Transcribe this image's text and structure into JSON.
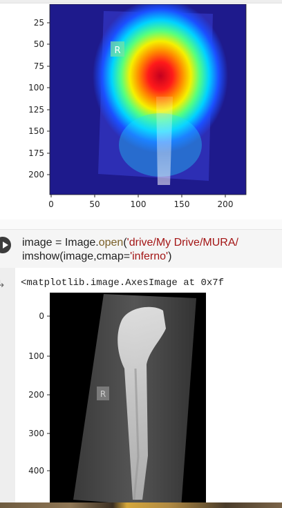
{
  "plot1": {
    "y_ticks": [
      "25",
      "50",
      "75",
      "100",
      "125",
      "150",
      "175",
      "200"
    ],
    "x_ticks": [
      "0",
      "50",
      "100",
      "150",
      "200"
    ],
    "marker_letter": "R"
  },
  "code_cell": {
    "line1_a": "image = Image.",
    "line1_fn": "open",
    "line1_b": "(",
    "line1_str": "'drive/My Drive/MURA/",
    "line2_a": "imshow(image,cmap=",
    "line2_str": "'inferno'",
    "line2_b": ")"
  },
  "output": {
    "icon": "output-arrow-icon",
    "text": "<matplotlib.image.AxesImage at 0x7f",
    "y_ticks": [
      "0",
      "100",
      "200",
      "300",
      "400"
    ],
    "marker_letter": "R"
  },
  "colors": {
    "heatmap_background": "#1e1a8c",
    "heat_core": "#d4002a",
    "inferno_bg": "#000000"
  }
}
